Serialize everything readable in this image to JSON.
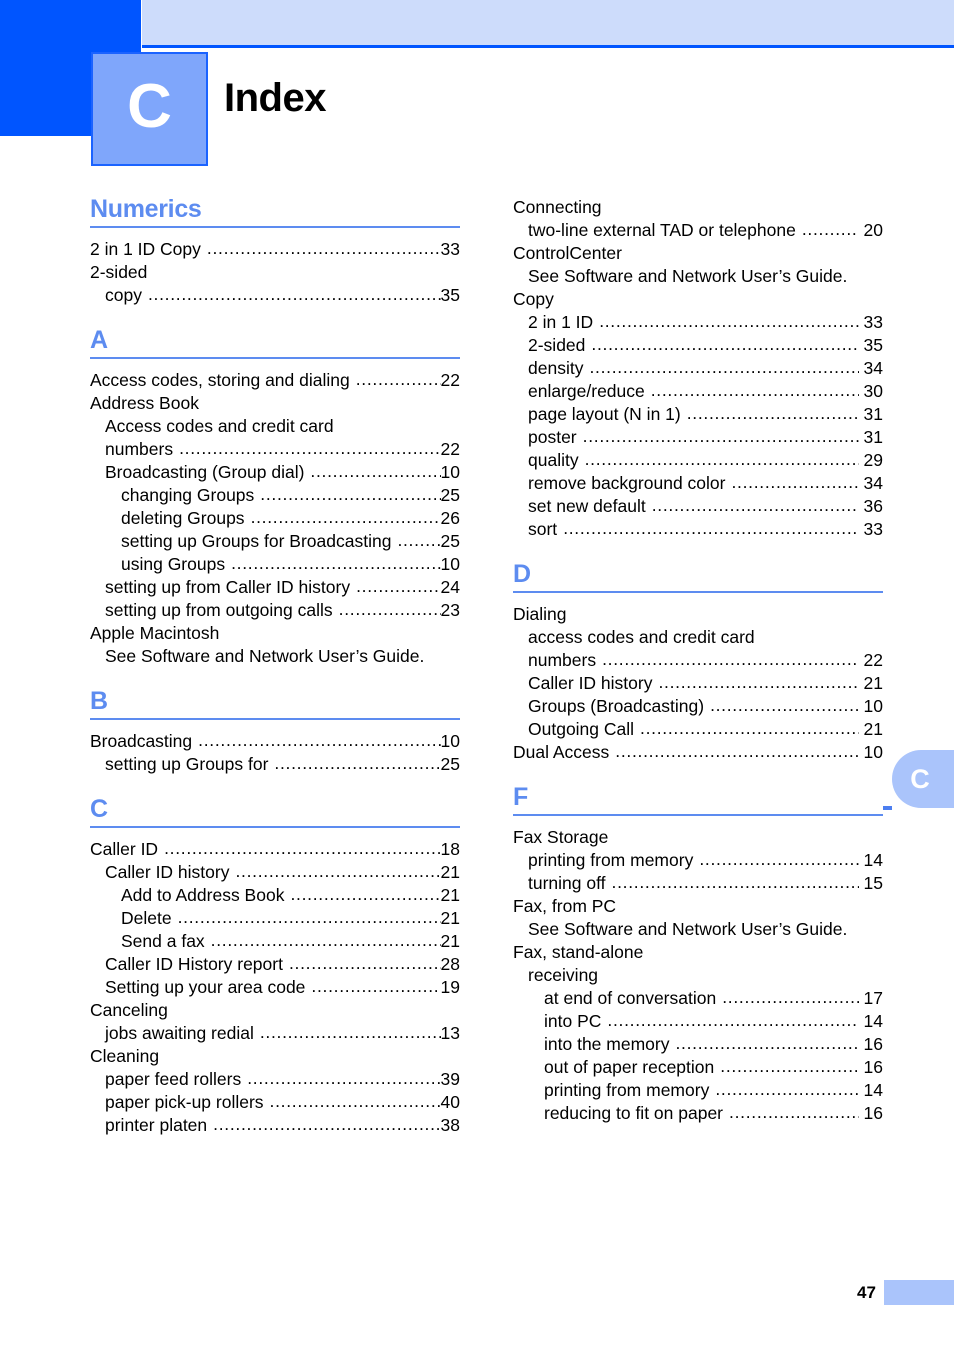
{
  "header": {
    "chapter_letter": "C",
    "title": "Index"
  },
  "side_tab": {
    "letter": "C"
  },
  "footer": {
    "page_number": "47"
  },
  "colors": {
    "dark_blue": "#0055ff",
    "lavender": "#cddcfb",
    "badge_blue": "#7fa6fb",
    "heading_blue": "#5d8cf0",
    "tab_blue": "#aac4fb"
  },
  "left_column": [
    {
      "letter": "Numerics",
      "entries": [
        {
          "level": 0,
          "label": "2 in 1 ID Copy",
          "page": "33"
        },
        {
          "level": 0,
          "label": "2-sided",
          "page": null
        },
        {
          "level": 1,
          "label": "copy",
          "page": "35"
        }
      ]
    },
    {
      "letter": "A",
      "entries": [
        {
          "level": 0,
          "label": "Access codes, storing and dialing",
          "page": "22"
        },
        {
          "level": 0,
          "label": "Address Book",
          "page": null
        },
        {
          "level": 1,
          "label": "Access codes and credit card",
          "page": null
        },
        {
          "level": 1,
          "label": "numbers",
          "page": "22"
        },
        {
          "level": 1,
          "label": "Broadcasting (Group dial)",
          "page": "10"
        },
        {
          "level": 2,
          "label": "changing Groups",
          "page": "25"
        },
        {
          "level": 2,
          "label": "deleting Groups",
          "page": "26"
        },
        {
          "level": 2,
          "label": "setting up Groups for Broadcasting",
          "page": "25"
        },
        {
          "level": 2,
          "label": "using Groups",
          "page": "10"
        },
        {
          "level": 1,
          "label": "setting up from Caller ID history",
          "page": "24"
        },
        {
          "level": 1,
          "label": "setting up from outgoing calls",
          "page": "23"
        },
        {
          "level": 0,
          "label": "Apple Macintosh",
          "page": null
        },
        {
          "level": 1,
          "label": "See Software and Network User’s Guide.",
          "page": null
        }
      ]
    },
    {
      "letter": "B",
      "entries": [
        {
          "level": 0,
          "label": "Broadcasting",
          "page": "10"
        },
        {
          "level": 1,
          "label": "setting up Groups for",
          "page": "25"
        }
      ]
    },
    {
      "letter": "C",
      "entries": [
        {
          "level": 0,
          "label": "Caller ID",
          "page": "18"
        },
        {
          "level": 1,
          "label": "Caller ID history",
          "page": "21"
        },
        {
          "level": 2,
          "label": "Add to Address Book",
          "page": "21"
        },
        {
          "level": 2,
          "label": "Delete",
          "page": "21"
        },
        {
          "level": 2,
          "label": "Send a fax",
          "page": "21"
        },
        {
          "level": 1,
          "label": "Caller ID History report",
          "page": "28"
        },
        {
          "level": 1,
          "label": "Setting up your area code",
          "page": "19"
        },
        {
          "level": 0,
          "label": "Canceling",
          "page": null
        },
        {
          "level": 1,
          "label": "jobs awaiting redial",
          "page": "13"
        },
        {
          "level": 0,
          "label": "Cleaning",
          "page": null
        },
        {
          "level": 1,
          "label": "paper feed rollers",
          "page": "39"
        },
        {
          "level": 1,
          "label": "paper pick-up rollers",
          "page": "40"
        },
        {
          "level": 1,
          "label": "printer platen",
          "page": "38"
        }
      ]
    }
  ],
  "right_column": [
    {
      "letter": null,
      "entries": [
        {
          "level": 0,
          "label": "Connecting",
          "page": null
        },
        {
          "level": 1,
          "label": "two-line external TAD or telephone",
          "page": "20"
        },
        {
          "level": 0,
          "label": "ControlCenter",
          "page": null
        },
        {
          "level": 1,
          "label": "See Software and Network User’s Guide.",
          "page": null
        },
        {
          "level": 0,
          "label": "Copy",
          "page": null
        },
        {
          "level": 1,
          "label": "2 in 1 ID",
          "page": "33"
        },
        {
          "level": 1,
          "label": "2-sided",
          "page": "35"
        },
        {
          "level": 1,
          "label": "density",
          "page": "34"
        },
        {
          "level": 1,
          "label": "enlarge/reduce",
          "page": "30"
        },
        {
          "level": 1,
          "label": "page layout (N in 1)",
          "page": "31"
        },
        {
          "level": 1,
          "label": "poster",
          "page": "31"
        },
        {
          "level": 1,
          "label": "quality",
          "page": "29"
        },
        {
          "level": 1,
          "label": "remove background color",
          "page": "34"
        },
        {
          "level": 1,
          "label": "set new default",
          "page": "36"
        },
        {
          "level": 1,
          "label": "sort",
          "page": "33"
        }
      ]
    },
    {
      "letter": "D",
      "entries": [
        {
          "level": 0,
          "label": "Dialing",
          "page": null
        },
        {
          "level": 1,
          "label": "access codes and credit card",
          "page": null
        },
        {
          "level": 1,
          "label": "numbers",
          "page": "22"
        },
        {
          "level": 1,
          "label": "Caller ID history",
          "page": "21"
        },
        {
          "level": 1,
          "label": "Groups (Broadcasting)",
          "page": "10"
        },
        {
          "level": 1,
          "label": "Outgoing Call",
          "page": "21"
        },
        {
          "level": 0,
          "label": "Dual Access",
          "page": "10"
        }
      ]
    },
    {
      "letter": "F",
      "entries": [
        {
          "level": 0,
          "label": "Fax Storage",
          "page": null
        },
        {
          "level": 1,
          "label": "printing from memory",
          "page": "14"
        },
        {
          "level": 1,
          "label": "turning off",
          "page": "15"
        },
        {
          "level": 0,
          "label": "Fax, from PC",
          "page": null
        },
        {
          "level": 1,
          "label": "See Software and Network User’s Guide.",
          "page": null
        },
        {
          "level": 0,
          "label": "Fax, stand-alone",
          "page": null
        },
        {
          "level": 1,
          "label": "receiving",
          "page": null
        },
        {
          "level": 2,
          "label": "at end of conversation",
          "page": "17"
        },
        {
          "level": 2,
          "label": "into PC",
          "page": "14"
        },
        {
          "level": 2,
          "label": "into the memory",
          "page": "16"
        },
        {
          "level": 2,
          "label": "out of paper reception",
          "page": "16"
        },
        {
          "level": 2,
          "label": "printing from memory",
          "page": "14"
        },
        {
          "level": 2,
          "label": "reducing to fit on paper",
          "page": "16"
        }
      ]
    }
  ]
}
